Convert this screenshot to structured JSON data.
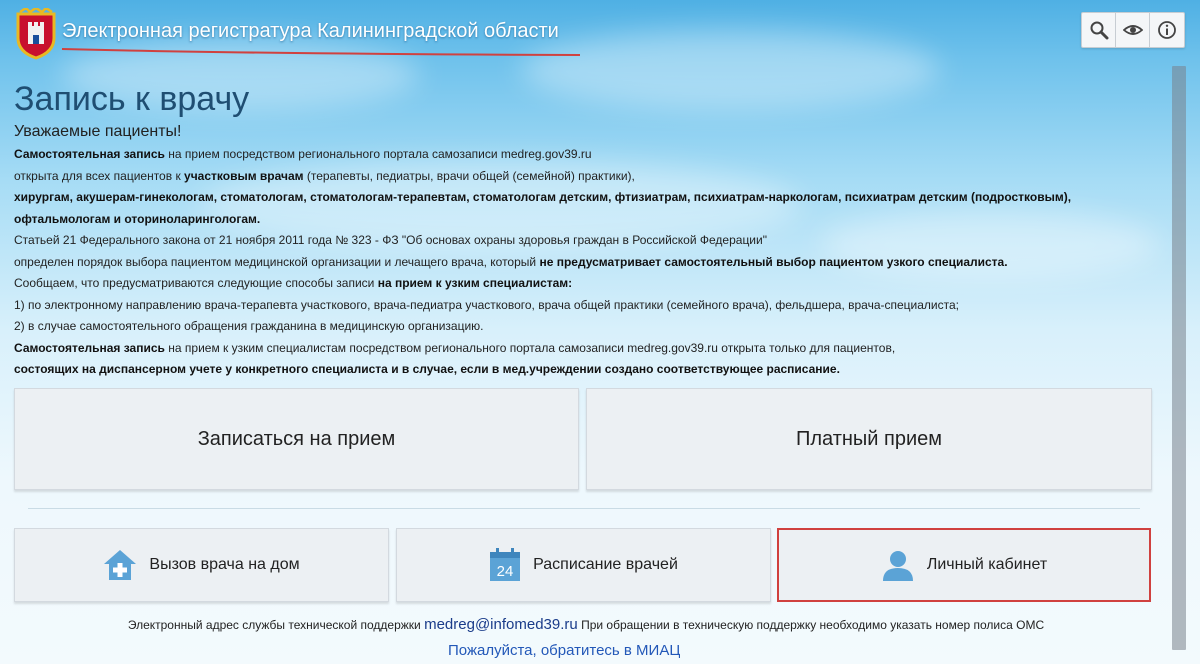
{
  "header": {
    "site_title": "Электронная регистратура Калининградской области"
  },
  "toolbar": {
    "items": [
      {
        "icon": "search-icon"
      },
      {
        "icon": "eye-icon"
      },
      {
        "icon": "info-icon"
      }
    ]
  },
  "main": {
    "page_title": "Запись к врачу",
    "greeting": "Уважаемые пациенты!",
    "paragraphs": {
      "p1_b": "Самостоятельная запись",
      "p1_t": " на прием посредством регионального портала самозаписи medreg.gov39.ru",
      "p2_t1": "открыта для всех пациентов к ",
      "p2_b": "участковым врачам",
      "p2_t2": " (терапевты, педиатры, врачи общей (семейной) практики),",
      "p3_b": "хирургам, акушерам-гинекологам, стоматологам, стоматологам-терапевтам, стоматологам детским, фтизиатрам, психиатрам-наркологам, психиатрам детским (подростковым), офтальмологам и оториноларингологам.",
      "p4_t": "Статьей 21 Федерального закона от 21 ноября 2011 года № 323 - ФЗ \"Об основах охраны здоровья граждан в Российской Федерации\"",
      "p5_t": "определен порядок выбора пациентом медицинской организации и лечащего врача, который ",
      "p5_b": "не предусматривает самостоятельный выбор пациентом узкого специалиста.",
      "p6_t": "Сообщаем, что предусматриваются следующие способы записи ",
      "p6_b": "на прием к узким специалистам:",
      "p7_t": "1) по электронному направлению врача-терапевта участкового, врача-педиатра участкового, врача общей практики (семейного врача), фельдшера, врача-специалиста;",
      "p8_t": "2) в случае самостоятельного обращения гражданина в медицинскую организацию.",
      "p9_b": "Самостоятельная запись",
      "p9_t": " на прием к узким специалистам посредством регионального портала самозаписи medreg.gov39.ru открыта только для пациентов,",
      "p10_b": "состоящих на диспансерном учете у конкретного специалиста и в случае, если в мед.учреждении создано соответствующее расписание."
    }
  },
  "buttons": {
    "appointment": "Записаться на прием",
    "paid": "Платный прием",
    "home_visit": "Вызов врача на дом",
    "schedule": "Расписание врачей",
    "calendar_day": "24",
    "cabinet": "Личный кабинет"
  },
  "footer": {
    "support_prefix": "Электронный адрес службы технической поддержки",
    "support_email": "medreg@infomed39.ru",
    "support_suffix": "При обращении в техническую поддержку необходимо указать номер полиса ОМС",
    "link_partial": "Пожалуйста, обратитесь в МИАЦ"
  },
  "colors": {
    "title": "#1f4e72",
    "icon_blue": "#5ba3d6",
    "active_border": "#d0413f",
    "email": "#1a3c8a"
  }
}
